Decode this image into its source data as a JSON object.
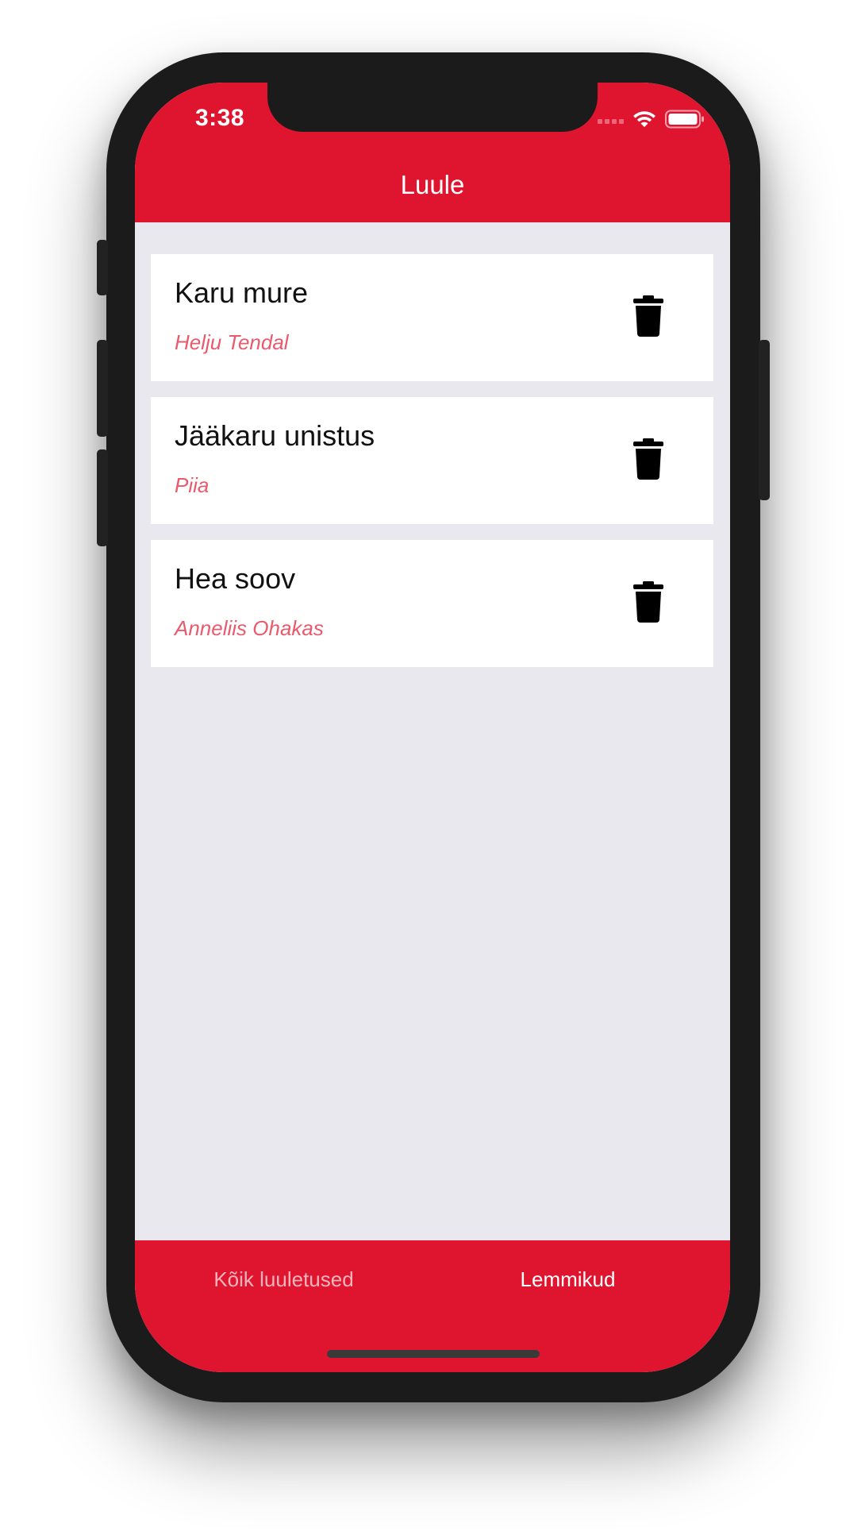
{
  "status_bar": {
    "time": "3:38"
  },
  "nav": {
    "title": "Luule"
  },
  "poems": [
    {
      "title": "Karu mure",
      "author": "Helju Tendal"
    },
    {
      "title": "Jääkaru unistus",
      "author": "Piia"
    },
    {
      "title": "Hea soov",
      "author": "Anneliis Ohakas"
    }
  ],
  "tabs": {
    "all_label": "Kõik luuletused",
    "favorites_label": "Lemmikud",
    "active": "favorites"
  },
  "icons": {
    "delete": "trash-icon",
    "wifi": "wifi-icon",
    "battery": "battery-icon",
    "signal": "signal-icon"
  },
  "colors": {
    "brand_red": "#df1530",
    "author_pink": "#e85a6c",
    "list_background": "#e9e8ee"
  }
}
